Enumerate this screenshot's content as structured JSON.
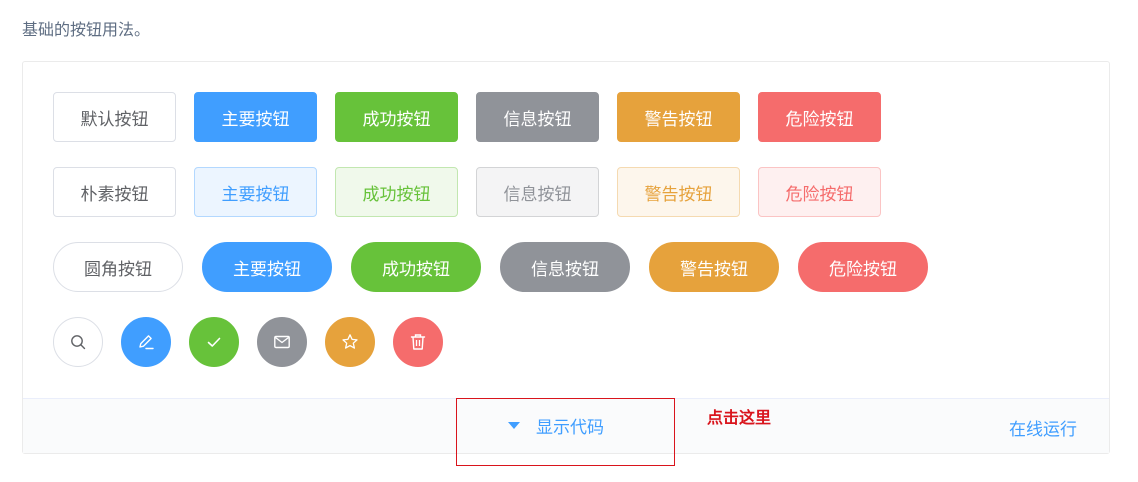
{
  "description": "基础的按钮用法。",
  "rows": {
    "normal": [
      "默认按钮",
      "主要按钮",
      "成功按钮",
      "信息按钮",
      "警告按钮",
      "危险按钮"
    ],
    "plain": [
      "朴素按钮",
      "主要按钮",
      "成功按钮",
      "信息按钮",
      "警告按钮",
      "危险按钮"
    ],
    "round": [
      "圆角按钮",
      "主要按钮",
      "成功按钮",
      "信息按钮",
      "警告按钮",
      "危险按钮"
    ]
  },
  "circle_icons": [
    "search-icon",
    "edit-icon",
    "check-icon",
    "message-icon",
    "star-icon",
    "delete-icon"
  ],
  "footer": {
    "show_code": "显示代码",
    "run_online": "在线运行"
  },
  "annotation": "点击这里",
  "colors": {
    "primary": "#409eff",
    "success": "#67c23a",
    "info": "#909399",
    "warning": "#e6a23c",
    "danger": "#f56c6c",
    "annotation": "#d9141c"
  }
}
